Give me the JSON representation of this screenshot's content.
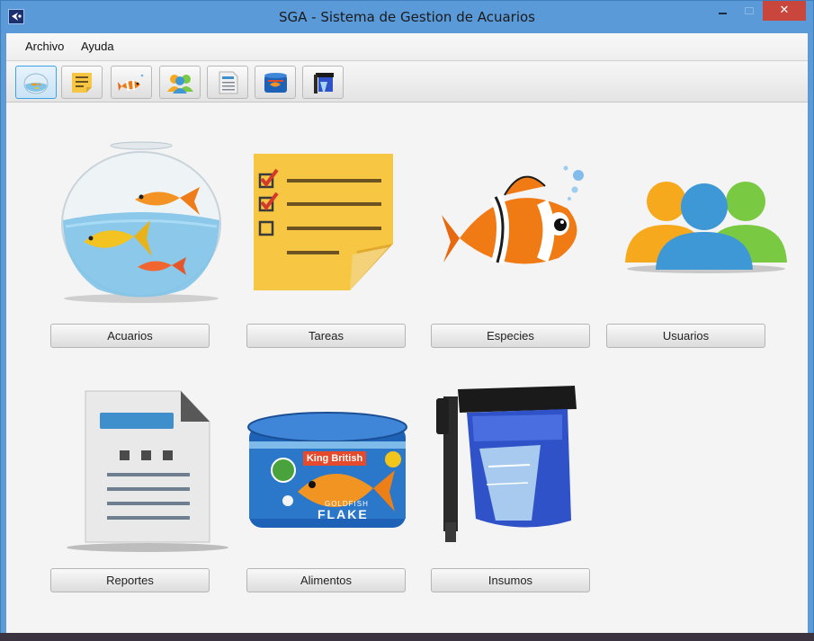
{
  "window": {
    "title": "SGA  -  Sistema de Gestion de Acuarios",
    "close_glyph": "✕",
    "icon": "app-logo-icon"
  },
  "menu": {
    "items": [
      {
        "label": "Archivo"
      },
      {
        "label": "Ayuda"
      }
    ]
  },
  "toolbar": {
    "buttons": [
      {
        "icon": "fishbowl-icon",
        "active": true
      },
      {
        "icon": "notes-icon"
      },
      {
        "icon": "clownfish-icon"
      },
      {
        "icon": "users-icon"
      },
      {
        "icon": "report-icon"
      },
      {
        "icon": "fish-food-icon"
      },
      {
        "icon": "aquarium-filter-icon"
      }
    ]
  },
  "modules": [
    {
      "label": "Acuarios",
      "icon": "fishbowl-icon"
    },
    {
      "label": "Tareas",
      "icon": "task-note-icon"
    },
    {
      "label": "Especies",
      "icon": "clownfish-icon"
    },
    {
      "label": "Usuarios",
      "icon": "users-icon"
    },
    {
      "label": "Reportes",
      "icon": "report-icon"
    },
    {
      "label": "Alimentos",
      "icon": "fish-food-icon",
      "product_text": [
        "King British",
        "GOLDFISH",
        "FLAKE"
      ]
    },
    {
      "label": "Insumos",
      "icon": "aquarium-filter-icon"
    }
  ],
  "colors": {
    "titlebar": "#5a9ad8",
    "close_button": "#c9463d",
    "active_tool": "#3ea2e6",
    "note_yellow": "#f7c744",
    "check_red": "#d33a2c"
  }
}
